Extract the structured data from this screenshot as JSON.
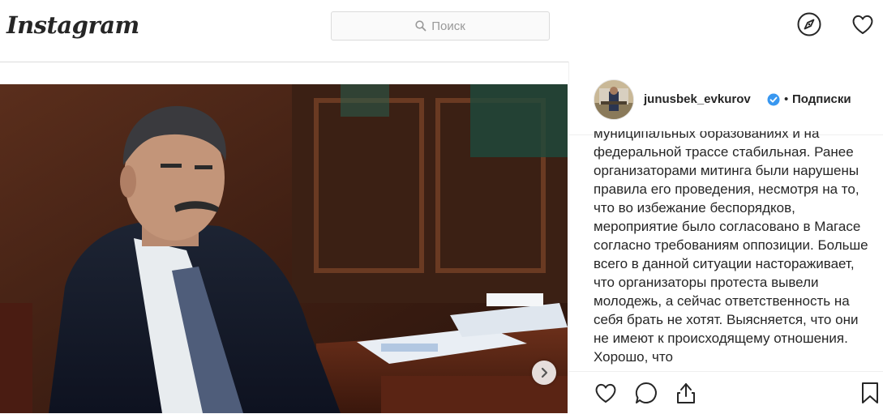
{
  "header": {
    "logo": "Instagram",
    "search_placeholder": "Поиск",
    "icons": [
      "explore-compass-icon",
      "activity-heart-icon"
    ]
  },
  "post": {
    "username": "junusbek_evkurov",
    "verified": true,
    "separator": "•",
    "follow_state": "Подписки",
    "caption": "муниципальных образованиях и на федеральной трассе стабильная. Ранее организаторами митинга были нарушены правила его проведения, несмотря на то, что во избежание беспорядков, мероприятие было согласовано в Магасе согласно требованиям оппозиции. Больше всего в данной ситуации настораживает, что организаторы протеста вывели молодежь, а сейчас ответственность на себя брать не хотят. Выясняется, что они не имеют к происходящему отношения. Хорошо, что",
    "actions": [
      "like-icon",
      "comment-icon",
      "share-icon",
      "save-icon"
    ],
    "media_nav": "next-arrow-icon"
  },
  "colors": {
    "text": "#262626",
    "border": "#dbdbdb",
    "verified": "#3897f0",
    "search_bg": "#fafafa"
  }
}
